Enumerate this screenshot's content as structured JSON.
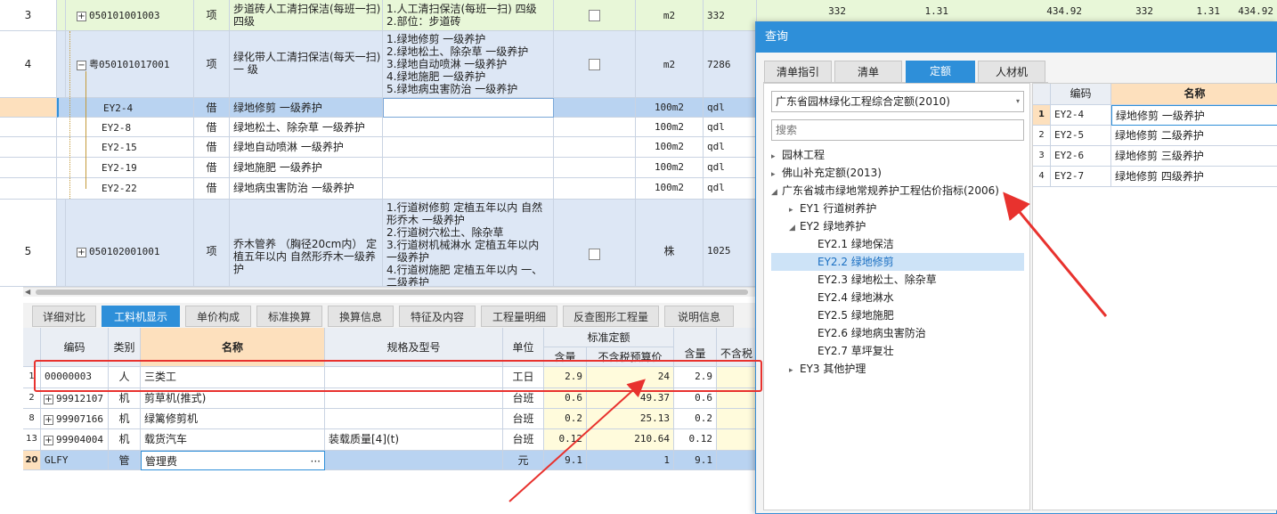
{
  "upper_table": {
    "rows": [
      {
        "seq": "3",
        "code": "050101001003",
        "type": "项",
        "name": "步道砖人工清扫保洁(每班一扫)四级",
        "features": "1.人工清扫保洁(每班一扫) 四级\n2.部位：步道砖",
        "unit": "m2",
        "qty": "332",
        "c1": "332",
        "c2": "1.31",
        "c3": "434.92",
        "c4": "332",
        "c5": "1.31",
        "c6": "434.92"
      },
      {
        "seq": "4",
        "code": "粤050101017001",
        "type": "项",
        "name": "绿化带人工清扫保洁(每天一扫)一 级",
        "features": "1.绿地修剪 一级养护\n2.绿地松土、除杂草 一级养护\n3.绿地自动喷淋 一级养护\n4.绿地施肥 一级养护\n5.绿地病虫害防治 一级养护",
        "unit": "m2",
        "qty": "7286"
      },
      {
        "code": "EY2-4",
        "type": "借",
        "name": "绿地修剪 一级养护",
        "unit": "100m2",
        "qty": "qdl"
      },
      {
        "code": "EY2-8",
        "type": "借",
        "name": "绿地松土、除杂草 一级养护",
        "unit": "100m2",
        "qty": "qdl"
      },
      {
        "code": "EY2-15",
        "type": "借",
        "name": "绿地自动喷淋 一级养护",
        "unit": "100m2",
        "qty": "qdl"
      },
      {
        "code": "EY2-19",
        "type": "借",
        "name": "绿地施肥 一级养护",
        "unit": "100m2",
        "qty": "qdl"
      },
      {
        "code": "EY2-22",
        "type": "借",
        "name": "绿地病虫害防治 一级养护",
        "unit": "100m2",
        "qty": "qdl"
      },
      {
        "seq": "5",
        "code": "050102001001",
        "type": "项",
        "name": "乔木管养 （胸径20cm内） 定植五年以内 自然形乔木一级养护",
        "features": "1.行道树修剪 定植五年以内 自然形乔木 一级养护\n2.行道树穴松土、除杂草\n3.行道树机械淋水 定植五年以内 一级养护\n4.行道树施肥 定植五年以内 一、二级养护",
        "unit": "株",
        "qty": "1025"
      }
    ]
  },
  "bottom_tabs": [
    "详细对比",
    "工料机显示",
    "单价构成",
    "标准换算",
    "换算信息",
    "特征及内容",
    "工程量明细",
    "反查图形工程量",
    "说明信息"
  ],
  "lower_table": {
    "headers": {
      "code": "编码",
      "type": "类别",
      "name": "名称",
      "spec": "规格及型号",
      "unit": "单位",
      "group": "标准定额",
      "qty": "含量",
      "price": "不含税预算价",
      "qty2": "含量",
      "price2": "不含税"
    },
    "rows": [
      {
        "seq": "1",
        "code": "00000003",
        "type": "人",
        "name": "三类工",
        "spec": "",
        "unit": "工日",
        "qty": "2.9",
        "price": "24",
        "qty2": "2.9"
      },
      {
        "seq": "2",
        "code": "99912107",
        "type": "机",
        "name": "剪草机(推式)",
        "spec": "",
        "unit": "台班",
        "qty": "0.6",
        "price": "49.37",
        "qty2": "0.6"
      },
      {
        "seq": "8",
        "code": "99907166",
        "type": "机",
        "name": "绿篱修剪机",
        "spec": "",
        "unit": "台班",
        "qty": "0.2",
        "price": "25.13",
        "qty2": "0.2"
      },
      {
        "seq": "13",
        "code": "99904004",
        "type": "机",
        "name": "载货汽车",
        "spec": "装载质量[4](t)",
        "unit": "台班",
        "qty": "0.12",
        "price": "210.64",
        "qty2": "0.12"
      },
      {
        "seq": "20",
        "code": "GLFY",
        "type": "管",
        "name": "管理费",
        "spec": "",
        "unit": "元",
        "qty": "9.1",
        "price": "1",
        "qty2": "9.1"
      }
    ]
  },
  "dialog": {
    "title": "查询",
    "tabs": [
      "清单指引",
      "清单",
      "定额",
      "人材机"
    ],
    "library": "广东省园林绿化工程综合定额(2010)",
    "search_placeholder": "搜索",
    "tree": [
      {
        "label": "园林工程",
        "level": 0,
        "arrow": "▸"
      },
      {
        "label": "佛山补充定额(2013)",
        "level": 0,
        "arrow": "▸"
      },
      {
        "label": "广东省城市绿地常规养护工程估价指标(2006)",
        "level": 0,
        "arrow": "◢"
      },
      {
        "label": "EY1 行道树养护",
        "level": 1,
        "arrow": "▸"
      },
      {
        "label": "EY2 绿地养护",
        "level": 1,
        "arrow": "◢"
      },
      {
        "label": "EY2.1 绿地保洁",
        "level": 2,
        "arrow": ""
      },
      {
        "label": "EY2.2 绿地修剪",
        "level": 2,
        "arrow": "",
        "selected": true
      },
      {
        "label": "EY2.3 绿地松土、除杂草",
        "level": 2,
        "arrow": ""
      },
      {
        "label": "EY2.4 绿地淋水",
        "level": 2,
        "arrow": ""
      },
      {
        "label": "EY2.5 绿地施肥",
        "level": 2,
        "arrow": ""
      },
      {
        "label": "EY2.6 绿地病虫害防治",
        "level": 2,
        "arrow": ""
      },
      {
        "label": "EY2.7 草坪复壮",
        "level": 2,
        "arrow": ""
      },
      {
        "label": "EY3 其他护理",
        "level": 1,
        "arrow": "▸"
      }
    ],
    "result_headers": {
      "code": "编码",
      "name": "名称"
    },
    "results": [
      {
        "seq": "1",
        "code": "EY2-4",
        "name": "绿地修剪 一级养护"
      },
      {
        "seq": "2",
        "code": "EY2-5",
        "name": "绿地修剪 二级养护"
      },
      {
        "seq": "3",
        "code": "EY2-6",
        "name": "绿地修剪 三级养护"
      },
      {
        "seq": "4",
        "code": "EY2-7",
        "name": "绿地修剪 四级养护"
      }
    ]
  },
  "colors": {
    "accent": "#2e8fd9",
    "annotation": "#e8322e",
    "selected_row": "#b9d3f1",
    "green_row": "#e8f7d8",
    "blue_row": "#dde7f5",
    "yellow_cell": "#fffbdc"
  }
}
